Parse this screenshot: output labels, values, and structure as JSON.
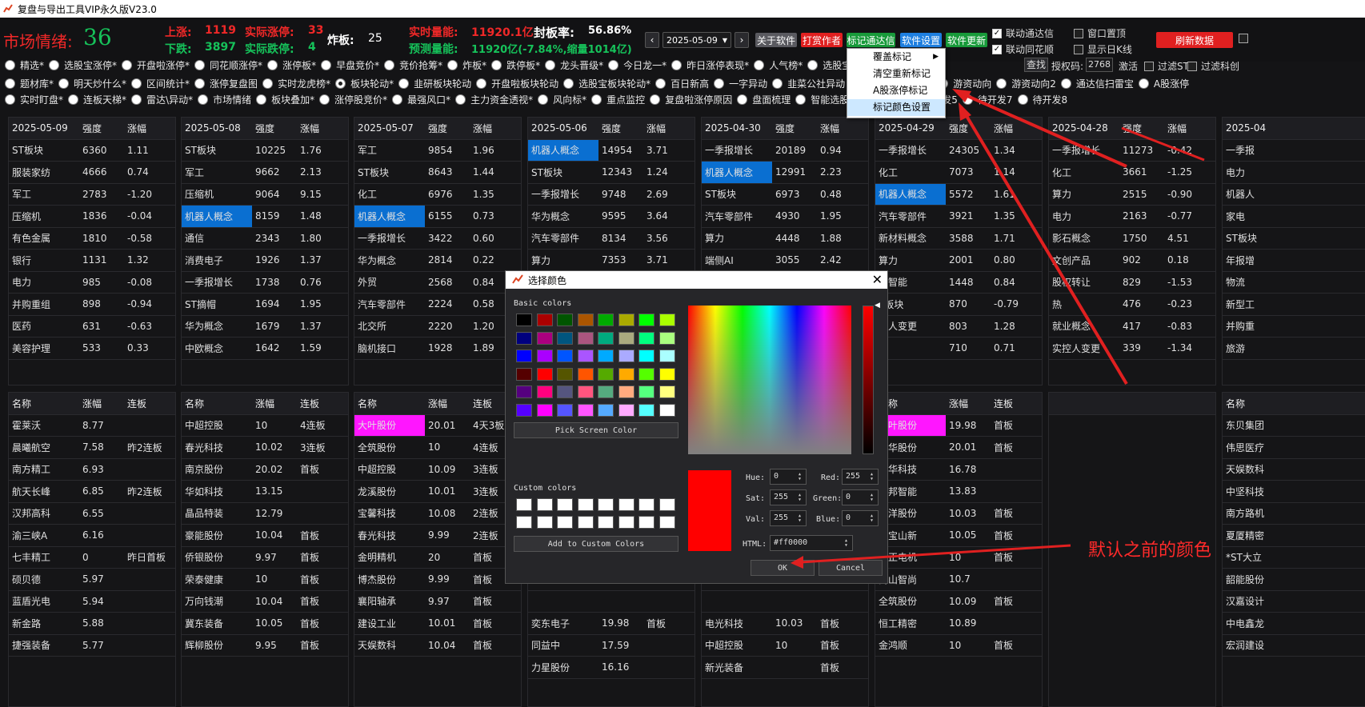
{
  "window_title": "复盘与导出工具VIP永久版V23.0",
  "header": {
    "mood_label": "市场情绪:",
    "mood_value": "36",
    "up_label": "上涨:",
    "up_value": "1119",
    "real_limitup_label": "实际涨停:",
    "real_limitup_value": "33",
    "down_label": "下跌:",
    "down_value": "3897",
    "real_limitdown_label": "实际跌停:",
    "real_limitdown_value": "4",
    "broken_label": "炸板:",
    "broken_value": "25",
    "volume_label": "实时量能:",
    "volume_value": "11920.1亿",
    "seal_label": "封板率:",
    "seal_value": "56.86%",
    "forecast_label": "预测量能:",
    "forecast_value": "11920亿(-7.84%,缩量1014亿)",
    "date": "2025-05-09",
    "buttons": [
      "关于软件",
      "打赏作者",
      "标记通达信",
      "软件设置",
      "软件更新",
      "刷新数据"
    ],
    "checkboxes": [
      {
        "label": "联动通达信",
        "checked": true
      },
      {
        "label": "窗口置顶",
        "checked": false
      },
      {
        "label": "联动同花顺",
        "checked": true
      },
      {
        "label": "显示日K线",
        "checked": false
      }
    ]
  },
  "toolbar2": {
    "search": "查找",
    "auth_label": "授权码:",
    "auth_code": "2768",
    "activate": "激活",
    "filter_st": "过滤ST",
    "filter_cy": "过滤科创"
  },
  "radio_rows": [
    [
      "精选*",
      "选股宝涨停*",
      "开盘啦涨停*",
      "同花顺涨停*",
      "涨停板*",
      "早盘竞价*",
      "竞价抢筹*",
      "炸板*",
      "跌停板*",
      "龙头晋级*",
      "今日龙一*",
      "昨日涨停表现*",
      "人气榜*",
      "选股宝热点解读*"
    ],
    [
      "题材库*",
      "明天炒什么*",
      "区间统计*",
      "涨停复盘图",
      "实时龙虎榜*",
      "板块轮动*",
      "韭研板块轮动",
      "开盘啦板块轮动",
      "选股宝板块轮动*",
      "百日新高",
      "一字异动",
      "韭菜公社异动",
      "游",
      "龙虎席位",
      "游资动向",
      "游资动向2",
      "通达信扫雷宝",
      "A股涨停"
    ],
    [
      "实时盯盘*",
      "连板天梯*",
      "雷达\\异动*",
      "市场情绪",
      "板块叠加*",
      "涨停股竞价*",
      "最强风口*",
      "主力资金透视*",
      "风向标*",
      "重点监控",
      "复盘啦涨停原因",
      "盘面梳理",
      "智能选股*",
      "自选股",
      "待开发5",
      "待开发7",
      "待开发8"
    ]
  ],
  "menu": {
    "items": [
      "覆盖标记",
      "清空重新标记",
      "A股涨停标记",
      "标记颜色设置"
    ]
  },
  "top_panels": [
    {
      "header": [
        "2025-05-09",
        "强度",
        "涨幅"
      ],
      "rows": [
        [
          "ST板块",
          "6360",
          "1.11"
        ],
        [
          "服装家纺",
          "4666",
          "0.74"
        ],
        [
          "军工",
          "2783",
          "-1.20"
        ],
        [
          "压缩机",
          "1836",
          "-0.04"
        ],
        [
          "有色金属",
          "1810",
          "-0.58"
        ],
        [
          "银行",
          "1131",
          "1.32"
        ],
        [
          "电力",
          "985",
          "-0.08"
        ],
        [
          "并购重组",
          "898",
          "-0.94"
        ],
        [
          "医药",
          "631",
          "-0.63"
        ],
        [
          "美容护理",
          "533",
          "0.33"
        ]
      ]
    },
    {
      "header": [
        "2025-05-08",
        "强度",
        "涨幅"
      ],
      "rows": [
        [
          "ST板块",
          "10225",
          "1.76"
        ],
        [
          "军工",
          "9662",
          "2.13"
        ],
        [
          "压缩机",
          "9064",
          "9.15"
        ],
        [
          "机器人概念",
          "8159",
          "1.48"
        ],
        [
          "通信",
          "2343",
          "1.80"
        ],
        [
          "消费电子",
          "1926",
          "1.37"
        ],
        [
          "一季报增长",
          "1738",
          "0.76"
        ],
        [
          "ST摘帽",
          "1694",
          "1.95"
        ],
        [
          "华为概念",
          "1679",
          "1.37"
        ],
        [
          "中欧概念",
          "1642",
          "1.59"
        ]
      ]
    },
    {
      "header": [
        "2025-05-07",
        "强度",
        "涨幅"
      ],
      "rows": [
        [
          "军工",
          "9854",
          "1.96"
        ],
        [
          "ST板块",
          "8643",
          "1.44"
        ],
        [
          "化工",
          "6976",
          "1.35"
        ],
        [
          "机器人概念",
          "6155",
          "0.73"
        ],
        [
          "一季报增长",
          "3422",
          "0.60"
        ],
        [
          "华为概念",
          "2814",
          "0.22"
        ],
        [
          "外贸",
          "2568",
          "0.84"
        ],
        [
          "汽车零部件",
          "2224",
          "0.58"
        ],
        [
          "北交所",
          "2220",
          "1.20"
        ],
        [
          "脑机接口",
          "1928",
          "1.89"
        ]
      ]
    },
    {
      "header": [
        "2025-05-06",
        "强度",
        "涨幅"
      ],
      "rows": [
        [
          "机器人概念",
          "14954",
          "3.71"
        ],
        [
          "ST板块",
          "12343",
          "1.24"
        ],
        [
          "一季报增长",
          "9748",
          "2.69"
        ],
        [
          "华为概念",
          "9595",
          "3.64"
        ],
        [
          "汽车零部件",
          "8134",
          "3.56"
        ],
        [
          "算力",
          "7353",
          "3.71"
        ]
      ]
    },
    {
      "header": [
        "2025-04-30",
        "强度",
        "涨幅"
      ],
      "rows": [
        [
          "一季报增长",
          "20189",
          "0.94"
        ],
        [
          "机器人概念",
          "12991",
          "2.23"
        ],
        [
          "ST板块",
          "6973",
          "0.48"
        ],
        [
          "汽车零部件",
          "4930",
          "1.95"
        ],
        [
          "算力",
          "4448",
          "1.88"
        ],
        [
          "端侧AI",
          "3055",
          "2.42"
        ]
      ]
    },
    {
      "header": [
        "2025-04-29",
        "强度",
        "涨幅"
      ],
      "rows": [
        [
          "一季报增长",
          "24305",
          "1.34"
        ],
        [
          "化工",
          "7073",
          "1.14"
        ],
        [
          "机器人概念",
          "5572",
          "1.61"
        ],
        [
          "汽车零部件",
          "3921",
          "1.35"
        ],
        [
          "新材料概念",
          "3588",
          "1.71"
        ],
        [
          "算力",
          "2001",
          "0.80"
        ],
        [
          "工智能",
          "1448",
          "0.84"
        ],
        [
          "T板块",
          "870",
          "-0.79"
        ],
        [
          "控人变更",
          "803",
          "1.28"
        ],
        [
          "告",
          "710",
          "0.71"
        ]
      ]
    },
    {
      "header": [
        "2025-04-28",
        "强度",
        "涨幅"
      ],
      "rows": [
        [
          "一季报增长",
          "11273",
          "-0.42"
        ],
        [
          "化工",
          "3661",
          "-1.25"
        ],
        [
          "算力",
          "2515",
          "-0.90"
        ],
        [
          "电力",
          "2163",
          "-0.77"
        ],
        [
          "影石概念",
          "1750",
          "4.51"
        ],
        [
          "文创产品",
          "902",
          "0.18"
        ],
        [
          "股权转让",
          "829",
          "-1.53"
        ],
        [
          "热",
          "476",
          "-0.23"
        ],
        [
          "就业概念",
          "417",
          "-0.83"
        ],
        [
          "实控人变更",
          "339",
          "-1.34"
        ]
      ]
    },
    {
      "header": [
        "2025-04",
        "",
        ""
      ],
      "rows": [
        [
          "一季报",
          "",
          ""
        ],
        [
          "电力",
          "",
          ""
        ],
        [
          "机器人",
          "",
          ""
        ],
        [
          "家电",
          "",
          ""
        ],
        [
          "ST板块",
          "",
          ""
        ],
        [
          "年报增",
          "",
          ""
        ],
        [
          "物流",
          "",
          ""
        ],
        [
          "新型工",
          "",
          ""
        ],
        [
          "并购重",
          "",
          ""
        ],
        [
          "旅游",
          "",
          ""
        ]
      ]
    }
  ],
  "bottom_panels": [
    {
      "header": [
        "名称",
        "涨幅",
        "连板"
      ],
      "rows": [
        [
          "霍莱沃",
          "8.77",
          ""
        ],
        [
          "晨曦航空",
          "7.58",
          "昨2连板"
        ],
        [
          "南方精工",
          "6.93",
          ""
        ],
        [
          "航天长峰",
          "6.85",
          "昨2连板"
        ],
        [
          "汉邦高科",
          "6.55",
          ""
        ],
        [
          "渝三峡A",
          "6.16",
          ""
        ],
        [
          "七丰精工",
          "0",
          "昨日首板"
        ],
        [
          "硕贝德",
          "5.97",
          ""
        ],
        [
          "蓝盾光电",
          "5.94",
          ""
        ],
        [
          "新金路",
          "5.88",
          ""
        ],
        [
          "捷强装备",
          "5.77",
          ""
        ]
      ]
    },
    {
      "header": [
        "名称",
        "涨幅",
        "连板"
      ],
      "rows": [
        [
          "中超控股",
          "10",
          "4连板"
        ],
        [
          "春光科技",
          "10.02",
          "3连板"
        ],
        [
          "南京股份",
          "20.02",
          "首板"
        ],
        [
          "华如科技",
          "13.15",
          ""
        ],
        [
          "晶品特装",
          "12.79",
          ""
        ],
        [
          "豪能股份",
          "10.04",
          "首板"
        ],
        [
          "侨银股份",
          "9.97",
          "首板"
        ],
        [
          "荣泰健康",
          "10",
          "首板"
        ],
        [
          "万向钱潮",
          "10.04",
          "首板"
        ],
        [
          "冀东装备",
          "10.05",
          "首板"
        ],
        [
          "辉柳股份",
          "9.95",
          "首板"
        ]
      ]
    },
    {
      "header": [
        "名称",
        "涨幅",
        "连板"
      ],
      "rows": [
        [
          "大叶股份",
          "20.01",
          "4天3板"
        ],
        [
          "全筑股份",
          "10",
          "4连板"
        ],
        [
          "中超控股",
          "10.09",
          "3连板"
        ],
        [
          "龙溪股份",
          "10.01",
          "3连板"
        ],
        [
          "宝馨科技",
          "10.08",
          "2连板"
        ],
        [
          "春光科技",
          "9.99",
          "2连板"
        ],
        [
          "金明精机",
          "20",
          "首板"
        ],
        [
          "博杰股份",
          "9.99",
          "首板"
        ],
        [
          "襄阳轴承",
          "9.97",
          "首板"
        ],
        [
          "建设工业",
          "10.01",
          "首板"
        ],
        [
          "天娱数科",
          "10.04",
          "首板"
        ]
      ]
    },
    {
      "header": [
        "",
        "",
        ""
      ],
      "rows": [
        [
          "",
          "",
          ""
        ],
        [
          "",
          "",
          ""
        ],
        [
          "",
          "",
          ""
        ],
        [
          "",
          "",
          ""
        ],
        [
          "",
          "",
          ""
        ],
        [
          "",
          "",
          ""
        ],
        [
          "",
          "",
          ""
        ],
        [
          "",
          "",
          ""
        ],
        [
          "",
          "",
          ""
        ],
        [
          "奕东电子",
          "19.98",
          "首板"
        ],
        [
          "同益中",
          "17.59",
          ""
        ],
        [
          "力星股份",
          "16.16",
          ""
        ]
      ]
    },
    {
      "header": [
        "",
        "",
        ""
      ],
      "rows": [
        [
          "",
          "",
          ""
        ],
        [
          "",
          "",
          ""
        ],
        [
          "",
          "",
          ""
        ],
        [
          "",
          "",
          ""
        ],
        [
          "",
          "",
          ""
        ],
        [
          "",
          "",
          ""
        ],
        [
          "",
          "",
          ""
        ],
        [
          "",
          "",
          ""
        ],
        [
          "",
          "",
          ""
        ],
        [
          "电光科技",
          "10.03",
          "首板"
        ],
        [
          "中超控股",
          "10",
          "首板"
        ],
        [
          "新光装备",
          "",
          "首板"
        ]
      ]
    },
    {
      "header": [
        "名称",
        "涨幅",
        "连板"
      ],
      "rows": [
        [
          "大叶股份",
          "19.98",
          "首板"
        ],
        [
          "南华股份",
          "20.01",
          "首板"
        ],
        [
          "南华科技",
          "16.78",
          ""
        ],
        [
          "中邦智能",
          "13.83",
          ""
        ],
        [
          "盛洋股份",
          "10.03",
          "首板"
        ],
        [
          "东宝山新",
          "10.05",
          "首板"
        ],
        [
          "中正电机",
          "10",
          "首板"
        ],
        [
          "南山智尚",
          "10.7",
          ""
        ],
        [
          "全筑股份",
          "10.09",
          "首板"
        ],
        [
          "恒工精密",
          "10.89",
          ""
        ],
        [
          "金鸿顺",
          "10",
          "首板"
        ]
      ]
    },
    {
      "header": [
        "",
        "",
        ""
      ],
      "rows": []
    },
    {
      "header": [
        "名称",
        "",
        ""
      ],
      "rows": [
        [
          "东贝集团",
          "",
          ""
        ],
        [
          "伟思医疗",
          "",
          ""
        ],
        [
          "天娱数科",
          "",
          ""
        ],
        [
          "中坚科技",
          "",
          ""
        ],
        [
          "南方路机",
          "",
          ""
        ],
        [
          "夏厦精密",
          "",
          ""
        ],
        [
          "*ST大立",
          "",
          ""
        ],
        [
          "韶能股份",
          "",
          ""
        ],
        [
          "汉嘉设计",
          "",
          ""
        ],
        [
          "中电鑫龙",
          "",
          ""
        ],
        [
          "宏润建设",
          "",
          ""
        ]
      ]
    }
  ],
  "dialog": {
    "title": "选择颜色",
    "basic_label": "Basic colors",
    "pick": "Pick Screen Color",
    "custom_label": "Custom colors",
    "add": "Add to Custom Colors",
    "hue_label": "Hue:",
    "hue": "0",
    "sat_label": "Sat:",
    "sat": "255",
    "val_label": "Val:",
    "val": "255",
    "red_label": "Red:",
    "red": "255",
    "green_label": "Green:",
    "green": "0",
    "blue_label": "Blue:",
    "blue": "0",
    "html_label": "HTML:",
    "html": "#ff0000",
    "ok": "OK",
    "cancel": "Cancel",
    "basic_colors": [
      "#000000",
      "#aa0000",
      "#005500",
      "#aa5500",
      "#00aa00",
      "#aaaa00",
      "#00ff00",
      "#aaff00",
      "#00007f",
      "#aa007f",
      "#00557f",
      "#aa557f",
      "#00aa7f",
      "#aaaa7f",
      "#00ff7f",
      "#aaff7f",
      "#0000ff",
      "#aa00ff",
      "#0055ff",
      "#aa55ff",
      "#00aaff",
      "#aaaaff",
      "#00ffff",
      "#aaffff",
      "#550000",
      "#ff0000",
      "#555500",
      "#ff5500",
      "#55aa00",
      "#ffaa00",
      "#55ff00",
      "#ffff00",
      "#55007f",
      "#ff007f",
      "#55557f",
      "#ff557f",
      "#55aa7f",
      "#ffaa7f",
      "#55ff7f",
      "#ffff7f",
      "#5500ff",
      "#ff00ff",
      "#5555ff",
      "#ff55ff",
      "#55aaff",
      "#ffaaff",
      "#55ffff",
      "#ffffff"
    ]
  },
  "annotation": "默认之前的颜色"
}
